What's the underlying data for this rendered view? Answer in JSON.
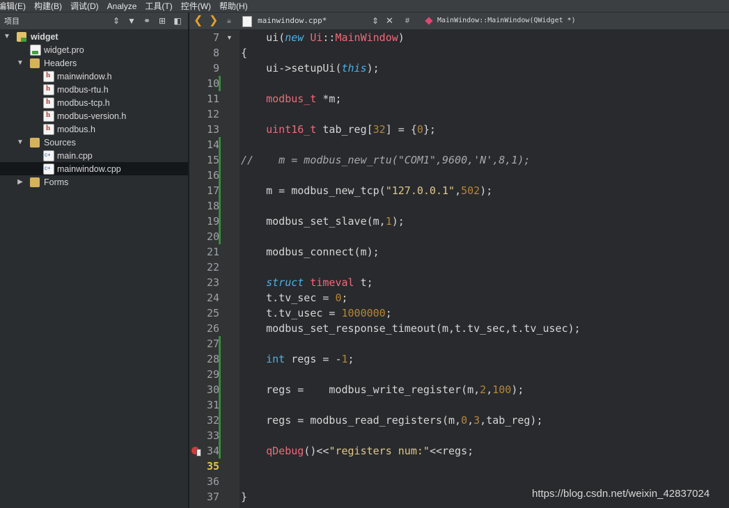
{
  "menu": [
    "编辑(E)",
    "构建(B)",
    "调试(D)",
    "Analyze",
    "工具(T)",
    "控件(W)",
    "帮助(H)"
  ],
  "left_toolbar": {
    "title": "项目",
    "icons": [
      "combo-arrows-icon",
      "filter-icon",
      "link-icon",
      "split-add-icon",
      "close-pane-icon"
    ]
  },
  "tree": [
    {
      "label": "widget",
      "depth": 0,
      "arrow": "▼",
      "icon": "proj",
      "bold": true
    },
    {
      "label": "widget.pro",
      "depth": 1,
      "arrow": "",
      "icon": "pro"
    },
    {
      "label": "Headers",
      "depth": 1,
      "arrow": "▼",
      "icon": "folder"
    },
    {
      "label": "mainwindow.h",
      "depth": 2,
      "arrow": "",
      "icon": "hfile"
    },
    {
      "label": "modbus-rtu.h",
      "depth": 2,
      "arrow": "",
      "icon": "hfile"
    },
    {
      "label": "modbus-tcp.h",
      "depth": 2,
      "arrow": "",
      "icon": "hfile"
    },
    {
      "label": "modbus-version.h",
      "depth": 2,
      "arrow": "",
      "icon": "hfile"
    },
    {
      "label": "modbus.h",
      "depth": 2,
      "arrow": "",
      "icon": "hfile"
    },
    {
      "label": "Sources",
      "depth": 1,
      "arrow": "▼",
      "icon": "folder"
    },
    {
      "label": "main.cpp",
      "depth": 2,
      "arrow": "",
      "icon": "cpp"
    },
    {
      "label": "mainwindow.cpp",
      "depth": 2,
      "arrow": "",
      "icon": "cpp",
      "selected": true
    },
    {
      "label": "Forms",
      "depth": 1,
      "arrow": "▶",
      "icon": "folder"
    }
  ],
  "editor_tab": {
    "back": "❮",
    "forward": "❯",
    "file": "mainwindow.cpp*",
    "combo_arrow": "⇕",
    "close": "✕",
    "hash": "#",
    "symbol": "MainWindow::MainWindow(QWidget *)"
  },
  "colors": {
    "accent_nav": "#e8a025",
    "modified_marker": "#3d8a3d",
    "current_line": "#e2c54a"
  },
  "lines": [
    {
      "n": 7,
      "t": [
        [
          "    ",
          ""
        ],
        [
          "ui",
          ""
        ],
        [
          "(",
          ""
        ],
        [
          "new",
          "kw"
        ],
        [
          " ",
          ""
        ],
        [
          "Ui",
          "ty"
        ],
        [
          "::",
          ""
        ],
        [
          "MainWindow",
          "ty"
        ],
        [
          ")",
          ""
        ]
      ]
    },
    {
      "n": 8,
      "fold": true,
      "t": [
        [
          "{",
          ""
        ]
      ]
    },
    {
      "n": 9,
      "t": [
        [
          "    ui->setupUi(",
          ""
        ],
        [
          "this",
          "kw"
        ],
        [
          ");",
          ""
        ]
      ]
    },
    {
      "n": 10,
      "mod": true,
      "t": []
    },
    {
      "n": 11,
      "t": [
        [
          "    ",
          ""
        ],
        [
          "modbus_t",
          "ty"
        ],
        [
          " *m;",
          ""
        ]
      ]
    },
    {
      "n": 12,
      "t": []
    },
    {
      "n": 13,
      "t": [
        [
          "    ",
          ""
        ],
        [
          "uint16_t",
          "ty"
        ],
        [
          " tab_reg[",
          ""
        ],
        [
          "32",
          "num"
        ],
        [
          "] = {",
          ""
        ],
        [
          "0",
          "num"
        ],
        [
          "};",
          ""
        ]
      ]
    },
    {
      "n": 14,
      "mod": true,
      "t": []
    },
    {
      "n": 15,
      "mod": true,
      "t": [
        [
          "//    m = modbus_new_rtu(\"COM1\",9600,'N',8,1);",
          "cm"
        ]
      ]
    },
    {
      "n": 16,
      "mod": true,
      "t": []
    },
    {
      "n": 17,
      "mod": true,
      "t": [
        [
          "    m = modbus_new_tcp(",
          ""
        ],
        [
          "\"127.0.0.1\"",
          "str"
        ],
        [
          ",",
          ""
        ],
        [
          "502",
          "num"
        ],
        [
          ");",
          ""
        ]
      ]
    },
    {
      "n": 18,
      "mod": true,
      "t": []
    },
    {
      "n": 19,
      "mod": true,
      "t": [
        [
          "    modbus_set_slave(m,",
          ""
        ],
        [
          "1",
          "num"
        ],
        [
          ");",
          ""
        ]
      ]
    },
    {
      "n": 20,
      "mod": true,
      "t": []
    },
    {
      "n": 21,
      "t": [
        [
          "    modbus_connect(m);",
          ""
        ]
      ]
    },
    {
      "n": 22,
      "t": []
    },
    {
      "n": 23,
      "t": [
        [
          "    ",
          ""
        ],
        [
          "struct",
          "kw"
        ],
        [
          " ",
          ""
        ],
        [
          "timeval",
          "ty"
        ],
        [
          " t;",
          ""
        ]
      ]
    },
    {
      "n": 24,
      "t": [
        [
          "    t.tv_sec = ",
          ""
        ],
        [
          "0",
          "num"
        ],
        [
          ";",
          ""
        ]
      ]
    },
    {
      "n": 25,
      "t": [
        [
          "    t.tv_usec = ",
          ""
        ],
        [
          "1000000",
          "num"
        ],
        [
          ";",
          ""
        ]
      ]
    },
    {
      "n": 26,
      "t": [
        [
          "    modbus_set_response_timeout(m,t.tv_sec,t.tv_usec);",
          ""
        ]
      ]
    },
    {
      "n": 27,
      "mod": true,
      "t": []
    },
    {
      "n": 28,
      "mod": true,
      "t": [
        [
          "    ",
          ""
        ],
        [
          "int",
          "kwn"
        ],
        [
          " regs = -",
          ""
        ],
        [
          "1",
          "num"
        ],
        [
          ";",
          ""
        ]
      ]
    },
    {
      "n": 29,
      "mod": true,
      "t": []
    },
    {
      "n": 30,
      "mod": true,
      "t": [
        [
          "    regs =    modbus_write_register(m,",
          ""
        ],
        [
          "2",
          "num"
        ],
        [
          ",",
          ""
        ],
        [
          "100",
          "num"
        ],
        [
          ");",
          ""
        ]
      ]
    },
    {
      "n": 31,
      "mod": true,
      "t": []
    },
    {
      "n": 32,
      "mod": true,
      "t": [
        [
          "    regs = modbus_read_registers(m,",
          ""
        ],
        [
          "0",
          "num"
        ],
        [
          ",",
          ""
        ],
        [
          "3",
          "num"
        ],
        [
          ",tab_reg);",
          ""
        ]
      ]
    },
    {
      "n": 33,
      "mod": true,
      "t": []
    },
    {
      "n": 34,
      "mod": true,
      "breakpoint": true,
      "t": [
        [
          "    ",
          ""
        ],
        [
          "qDebug",
          "ty"
        ],
        [
          "()<<",
          ""
        ],
        [
          "\"registers num:\"",
          "str"
        ],
        [
          "<<regs;",
          ""
        ]
      ]
    },
    {
      "n": 35,
      "current": true,
      "t": []
    },
    {
      "n": 36,
      "t": []
    },
    {
      "n": 37,
      "t": [
        [
          "}",
          ""
        ]
      ]
    }
  ],
  "watermark": "https://blog.csdn.net/weixin_42837024"
}
